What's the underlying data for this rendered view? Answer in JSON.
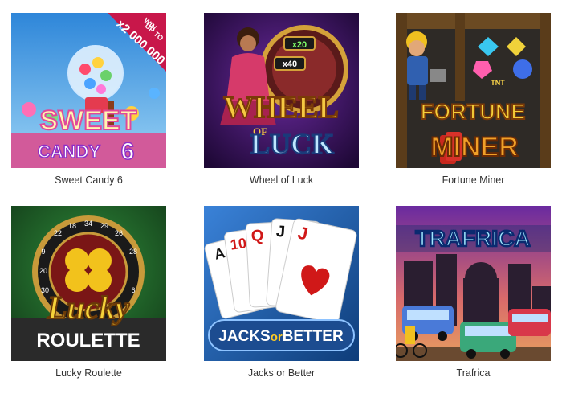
{
  "colors": {
    "sweet_candy_bg": "#3aa6e8",
    "banner_red": "#c8174a",
    "wheel_bg": "#3a0f5c",
    "fortune_bg": "#2a2a2a",
    "roulette_bg": "#1f6b2a",
    "jacks_bg": "#1f5fa8",
    "trafrica_bg": "#7a2aa0",
    "caption_text": "#333333"
  },
  "games": [
    {
      "name": "Sweet Candy 6",
      "art": {
        "banner_line1": "WIN",
        "banner_line2": "UP TO",
        "banner_amount": "x2 000 000",
        "title_top": "SWEET",
        "title_bottom": "CANDY",
        "title_number": "6"
      }
    },
    {
      "name": "Wheel of Luck",
      "art": {
        "multiplier_top": "x20",
        "multiplier_mid": "x40",
        "title_top": "WHEEL",
        "title_mid": "OF",
        "title_bottom": "LUCK"
      }
    },
    {
      "name": "Fortune Miner",
      "art": {
        "tnt_label": "TNT",
        "title_top": "FORTUNE",
        "title_bottom": "MINER"
      }
    },
    {
      "name": "Lucky Roulette",
      "art": {
        "wheel_numbers": [
          "22",
          "18",
          "34",
          "29",
          "26",
          "9",
          "28",
          "6",
          "30",
          "20"
        ],
        "title_top": "Lucky",
        "title_bottom": "ROULETTE"
      }
    },
    {
      "name": "Jacks or Better",
      "art": {
        "cards": [
          "A",
          "10",
          "Q",
          "J",
          "J"
        ],
        "title_jacks": "JACKS",
        "title_or": "or",
        "title_better": "BETTER"
      }
    },
    {
      "name": "Trafrica",
      "art": {
        "title": "TRAFRICA"
      }
    }
  ]
}
